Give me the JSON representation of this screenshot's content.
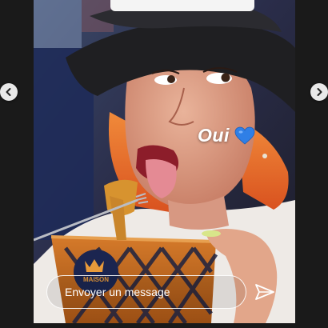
{
  "story": {
    "caption": "Oui",
    "caption_emoji": "blue-heart-icon",
    "reply_placeholder": "Envoyer un message",
    "logo_text": "MAISON"
  },
  "navigation": {
    "prev_icon": "chevron-left-icon",
    "next_icon": "chevron-right-icon"
  },
  "icons": {
    "send": "send-icon"
  },
  "colors": {
    "page_background": "#1a1a1a",
    "hat": "#1f1f22",
    "hair": "#e8682a",
    "heart": "#2f7fe6",
    "tub": "#c1691e"
  }
}
